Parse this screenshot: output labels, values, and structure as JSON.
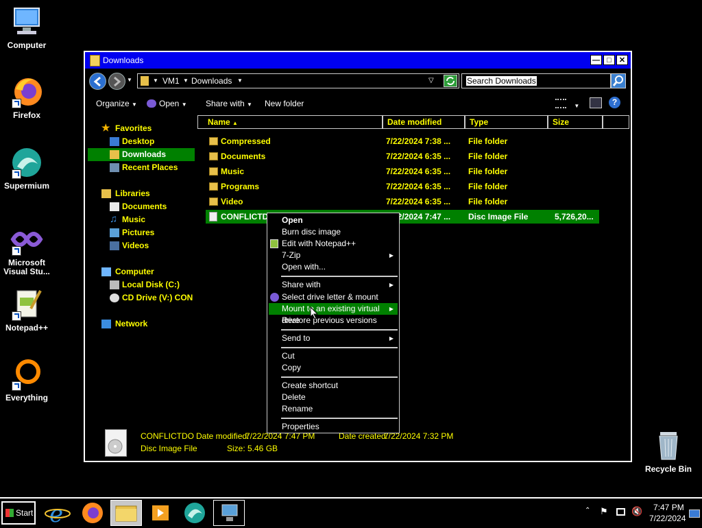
{
  "desktop": {
    "icons": [
      {
        "label": "Computer"
      },
      {
        "label": "Firefox"
      },
      {
        "label": "Supermium"
      },
      {
        "label": "Microsoft Visual Stu..."
      },
      {
        "label": "Notepad++"
      },
      {
        "label": "Everything"
      },
      {
        "label": "Recycle Bin"
      }
    ]
  },
  "window": {
    "title": "Downloads",
    "address": {
      "root": "VM1",
      "folder": "Downloads"
    },
    "search_placeholder": "Search Downloads",
    "toolbar": {
      "organize": "Organize",
      "open": "Open",
      "share_with": "Share with",
      "new_folder": "New folder"
    },
    "nav": {
      "favorites": "Favorites",
      "desktop": "Desktop",
      "downloads": "Downloads",
      "recent": "Recent Places",
      "libraries": "Libraries",
      "documents": "Documents",
      "music": "Music",
      "pictures": "Pictures",
      "videos": "Videos",
      "computer": "Computer",
      "local_disk": "Local Disk (C:)",
      "cd_drive": "CD Drive (V:) CON",
      "network": "Network"
    },
    "columns": {
      "name": "Name",
      "date": "Date modified",
      "type": "Type",
      "size": "Size"
    },
    "files": [
      {
        "name": "Compressed",
        "date": "7/22/2024 7:38 ...",
        "type": "File folder",
        "size": ""
      },
      {
        "name": "Documents",
        "date": "7/22/2024 6:35 ...",
        "type": "File folder",
        "size": ""
      },
      {
        "name": "Music",
        "date": "7/22/2024 6:35 ...",
        "type": "File folder",
        "size": ""
      },
      {
        "name": "Programs",
        "date": "7/22/2024 6:35 ...",
        "type": "File folder",
        "size": ""
      },
      {
        "name": "Video",
        "date": "7/22/2024 6:35 ...",
        "type": "File folder",
        "size": ""
      },
      {
        "name": "CONFLICTD",
        "date": "7/22/2024 7:47 ...",
        "type": "Disc Image File",
        "size": "5,726,20..."
      }
    ],
    "details": {
      "name": "CONFLICTDO",
      "date_modified_label": "Date modified:",
      "date_modified_value": "7/22/2024 7:47 PM",
      "date_created_label": "Date created:",
      "date_created_value": "7/22/2024 7:32 PM",
      "type": "Disc Image File",
      "size_label": "Size:",
      "size_value": "5.46 GB"
    }
  },
  "context_menu": {
    "items": [
      {
        "label": "Open"
      },
      {
        "label": "Burn disc image"
      },
      {
        "label": "Edit with Notepad++"
      },
      {
        "label": "7-Zip"
      },
      {
        "label": "Open with..."
      },
      {
        "label": "Share with"
      },
      {
        "label": "Select drive letter & mount"
      },
      {
        "label": "Mount to an existing virtual drive"
      },
      {
        "label": "Restore previous versions"
      },
      {
        "label": "Send to"
      },
      {
        "label": "Cut"
      },
      {
        "label": "Copy"
      },
      {
        "label": "Create shortcut"
      },
      {
        "label": "Delete"
      },
      {
        "label": "Rename"
      },
      {
        "label": "Properties"
      }
    ]
  },
  "taskbar": {
    "start": "Start",
    "time": "7:47 PM",
    "date": "7/22/2024"
  },
  "colors": {
    "title_bar": "#0000f0",
    "selection": "#008000",
    "text_yellow": "#ffff00"
  }
}
